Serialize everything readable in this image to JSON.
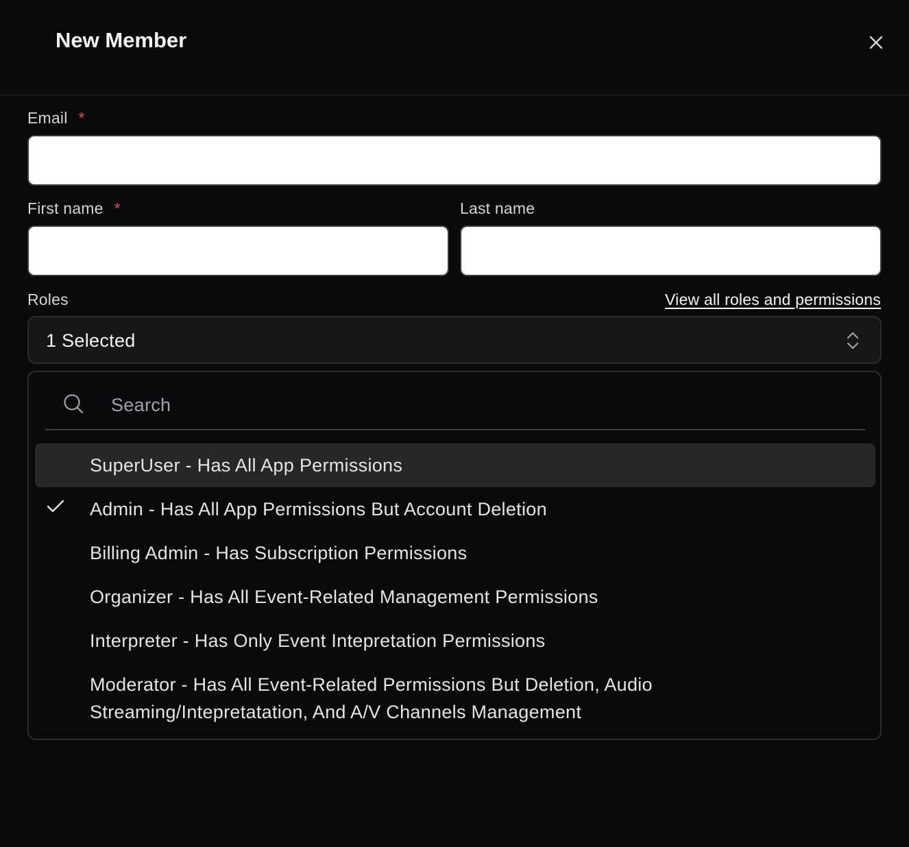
{
  "modal": {
    "title": "New Member",
    "close_icon": "close-icon"
  },
  "form": {
    "email": {
      "label": "Email",
      "required_mark": "*",
      "value": "",
      "placeholder": ""
    },
    "first_name": {
      "label": "First name",
      "required_mark": "*",
      "value": "",
      "placeholder": ""
    },
    "last_name": {
      "label": "Last name",
      "value": "",
      "placeholder": ""
    },
    "roles": {
      "label": "Roles",
      "link_text": "View all roles and permissions",
      "selected_text": "1 Selected",
      "chevron_icon": "chevron-up-down-icon",
      "dropdown": {
        "search_placeholder": "Search",
        "search_icon": "search-icon",
        "options": [
          {
            "label": "SuperUser - Has All App Permissions",
            "checked": false,
            "highlighted": true
          },
          {
            "label": "Admin - Has All App Permissions But Account Deletion",
            "checked": true,
            "highlighted": false
          },
          {
            "label": "Billing Admin - Has Subscription Permissions",
            "checked": false,
            "highlighted": false
          },
          {
            "label": "Organizer - Has All Event-Related Management Permissions",
            "checked": false,
            "highlighted": false
          },
          {
            "label": "Interpreter - Has Only Event Intepretation Permissions",
            "checked": false,
            "highlighted": false
          },
          {
            "label": "Moderator - Has All Event-Related Permissions But Deletion, Audio Streaming/Intepretatation, And A/V Channels Management",
            "checked": false,
            "highlighted": false
          }
        ]
      }
    }
  },
  "colors": {
    "background": "#0a0a0c",
    "required": "#e5484d",
    "highlight": "#27272a"
  }
}
